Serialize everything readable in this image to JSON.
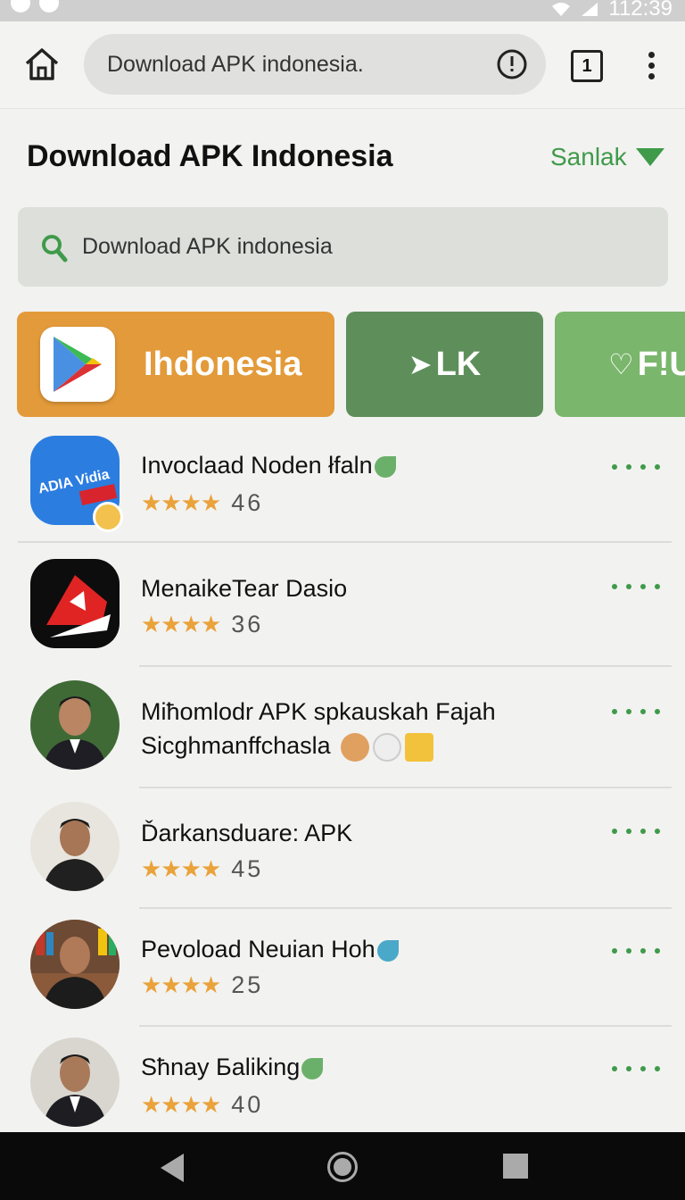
{
  "status_bar": {
    "time": "112:39"
  },
  "browser": {
    "url": "Download APK indonesia.",
    "tab_count": "1"
  },
  "page": {
    "title": "Download APK Indonesia",
    "sort_label": "Sanlak"
  },
  "search": {
    "value": "Download APK indonesia"
  },
  "categories": [
    {
      "label": "Ihdonesia",
      "color": "#e39a3a"
    },
    {
      "label": "LK",
      "color": "#5e8f5a"
    },
    {
      "label": "F!U",
      "color": "#7ab66c"
    }
  ],
  "apps": [
    {
      "name": "Invoclaad Noden łfaln",
      "stars": "★★★★",
      "rating": "46",
      "icon": "app-logo-icon"
    },
    {
      "name": "MenaikeTear Dasio",
      "stars": "★★★★",
      "rating": "36",
      "icon": "app-logo-icon"
    },
    {
      "name": "Miħomlodr APK spkauskah Fajah",
      "subtitle": "Sicghmanffchasla",
      "icon": "avatar-icon"
    },
    {
      "name": "Ďarkansduare: APK",
      "stars": "★★★★",
      "rating": "45",
      "icon": "avatar-icon"
    },
    {
      "name": "Pevoload Neuian Hoh",
      "stars": "★★★★",
      "rating": "25",
      "icon": "avatar-icon"
    },
    {
      "name": "Sħnay Бaliking",
      "stars": "★★★★",
      "rating": "40",
      "icon": "avatar-icon"
    }
  ],
  "colors": {
    "accent": "#3f9a4a",
    "star": "#eaa23a"
  }
}
